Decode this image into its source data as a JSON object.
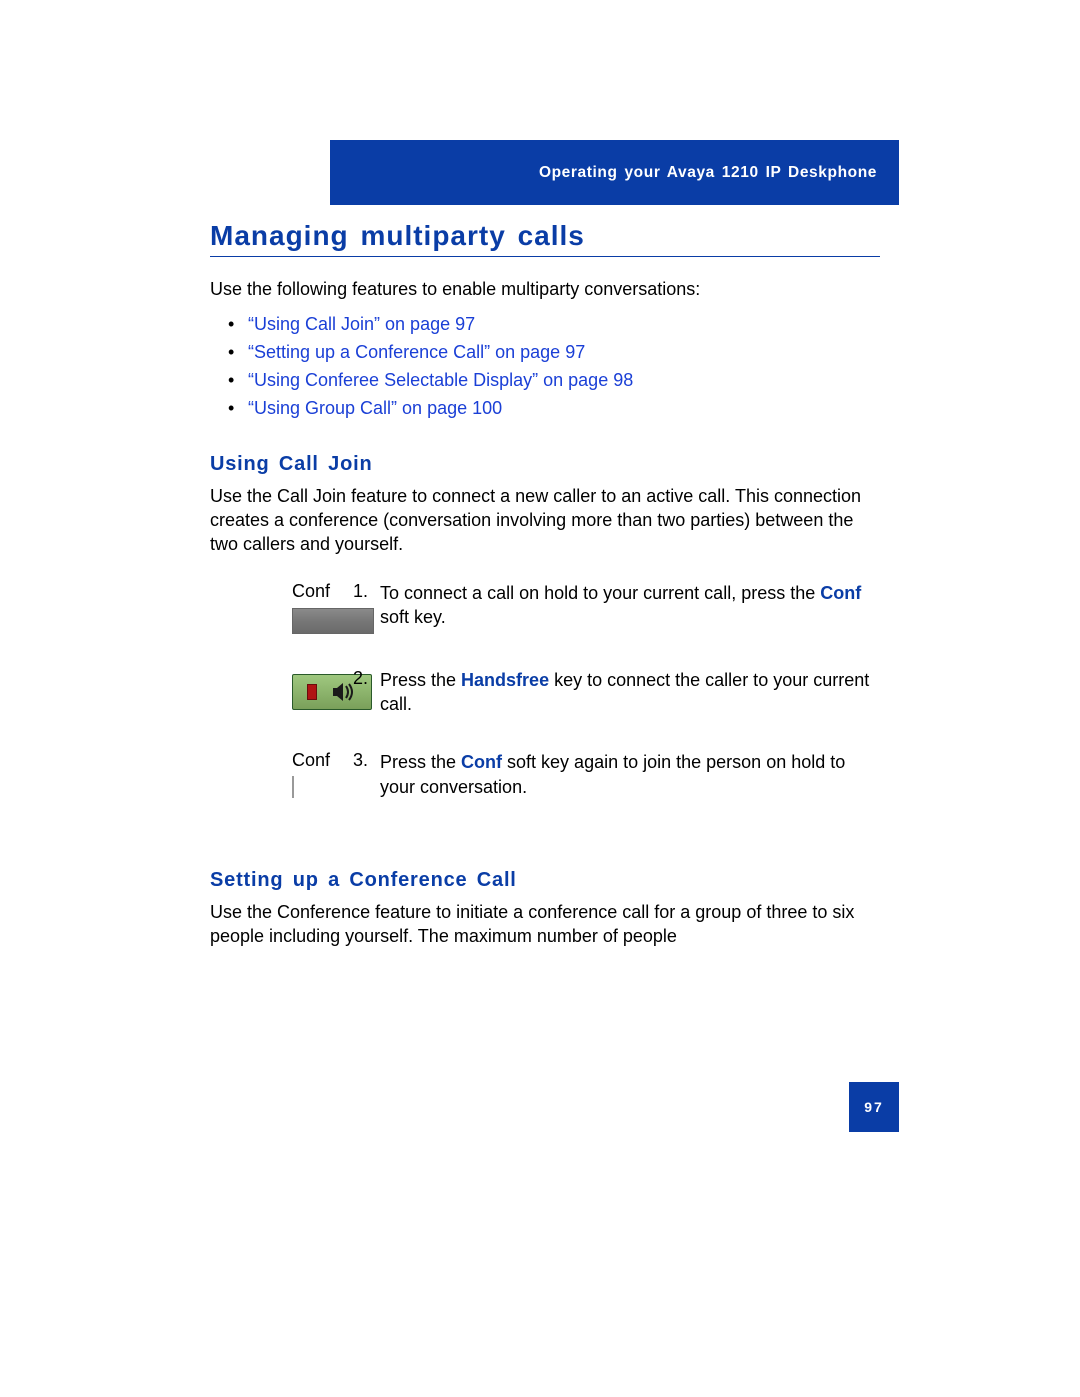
{
  "header": {
    "breadcrumb": "Operating your Avaya 1210 IP Deskphone"
  },
  "page_number": "97",
  "main": {
    "title": "Managing multiparty calls",
    "intro": "Use the following features to enable multiparty conversations:",
    "links": [
      "“Using Call Join” on page 97",
      "“Setting up a Conference Call” on page 97",
      "“Using Conferee Selectable Display” on page 98",
      "“Using Group Call” on page 100"
    ],
    "s1": {
      "title": "Using Call Join",
      "intro": "Use the Call Join feature to connect a new caller to an active call. This connection creates a conference (conversation involving more than two parties) between the two callers and yourself.",
      "conf_label": "Conf",
      "step1_num": "1.",
      "step1_a": "To connect a call on hold to your current call, press the ",
      "step1_key": "Conf",
      "step1_b": " soft key.",
      "step2_num": "2.",
      "step2_a": "Press the ",
      "step2_key": "Handsfree",
      "step2_b": " key to connect the caller to your current call.",
      "step3_num": "3.",
      "step3_a": "Press the ",
      "step3_key": "Conf",
      "step3_b": " soft key again to join the person on hold to your conversation."
    },
    "s2": {
      "title": "Setting up a Conference Call",
      "intro": "Use the Conference feature to initiate a conference call for a group of three to six people including yourself. The maximum number of people"
    }
  }
}
